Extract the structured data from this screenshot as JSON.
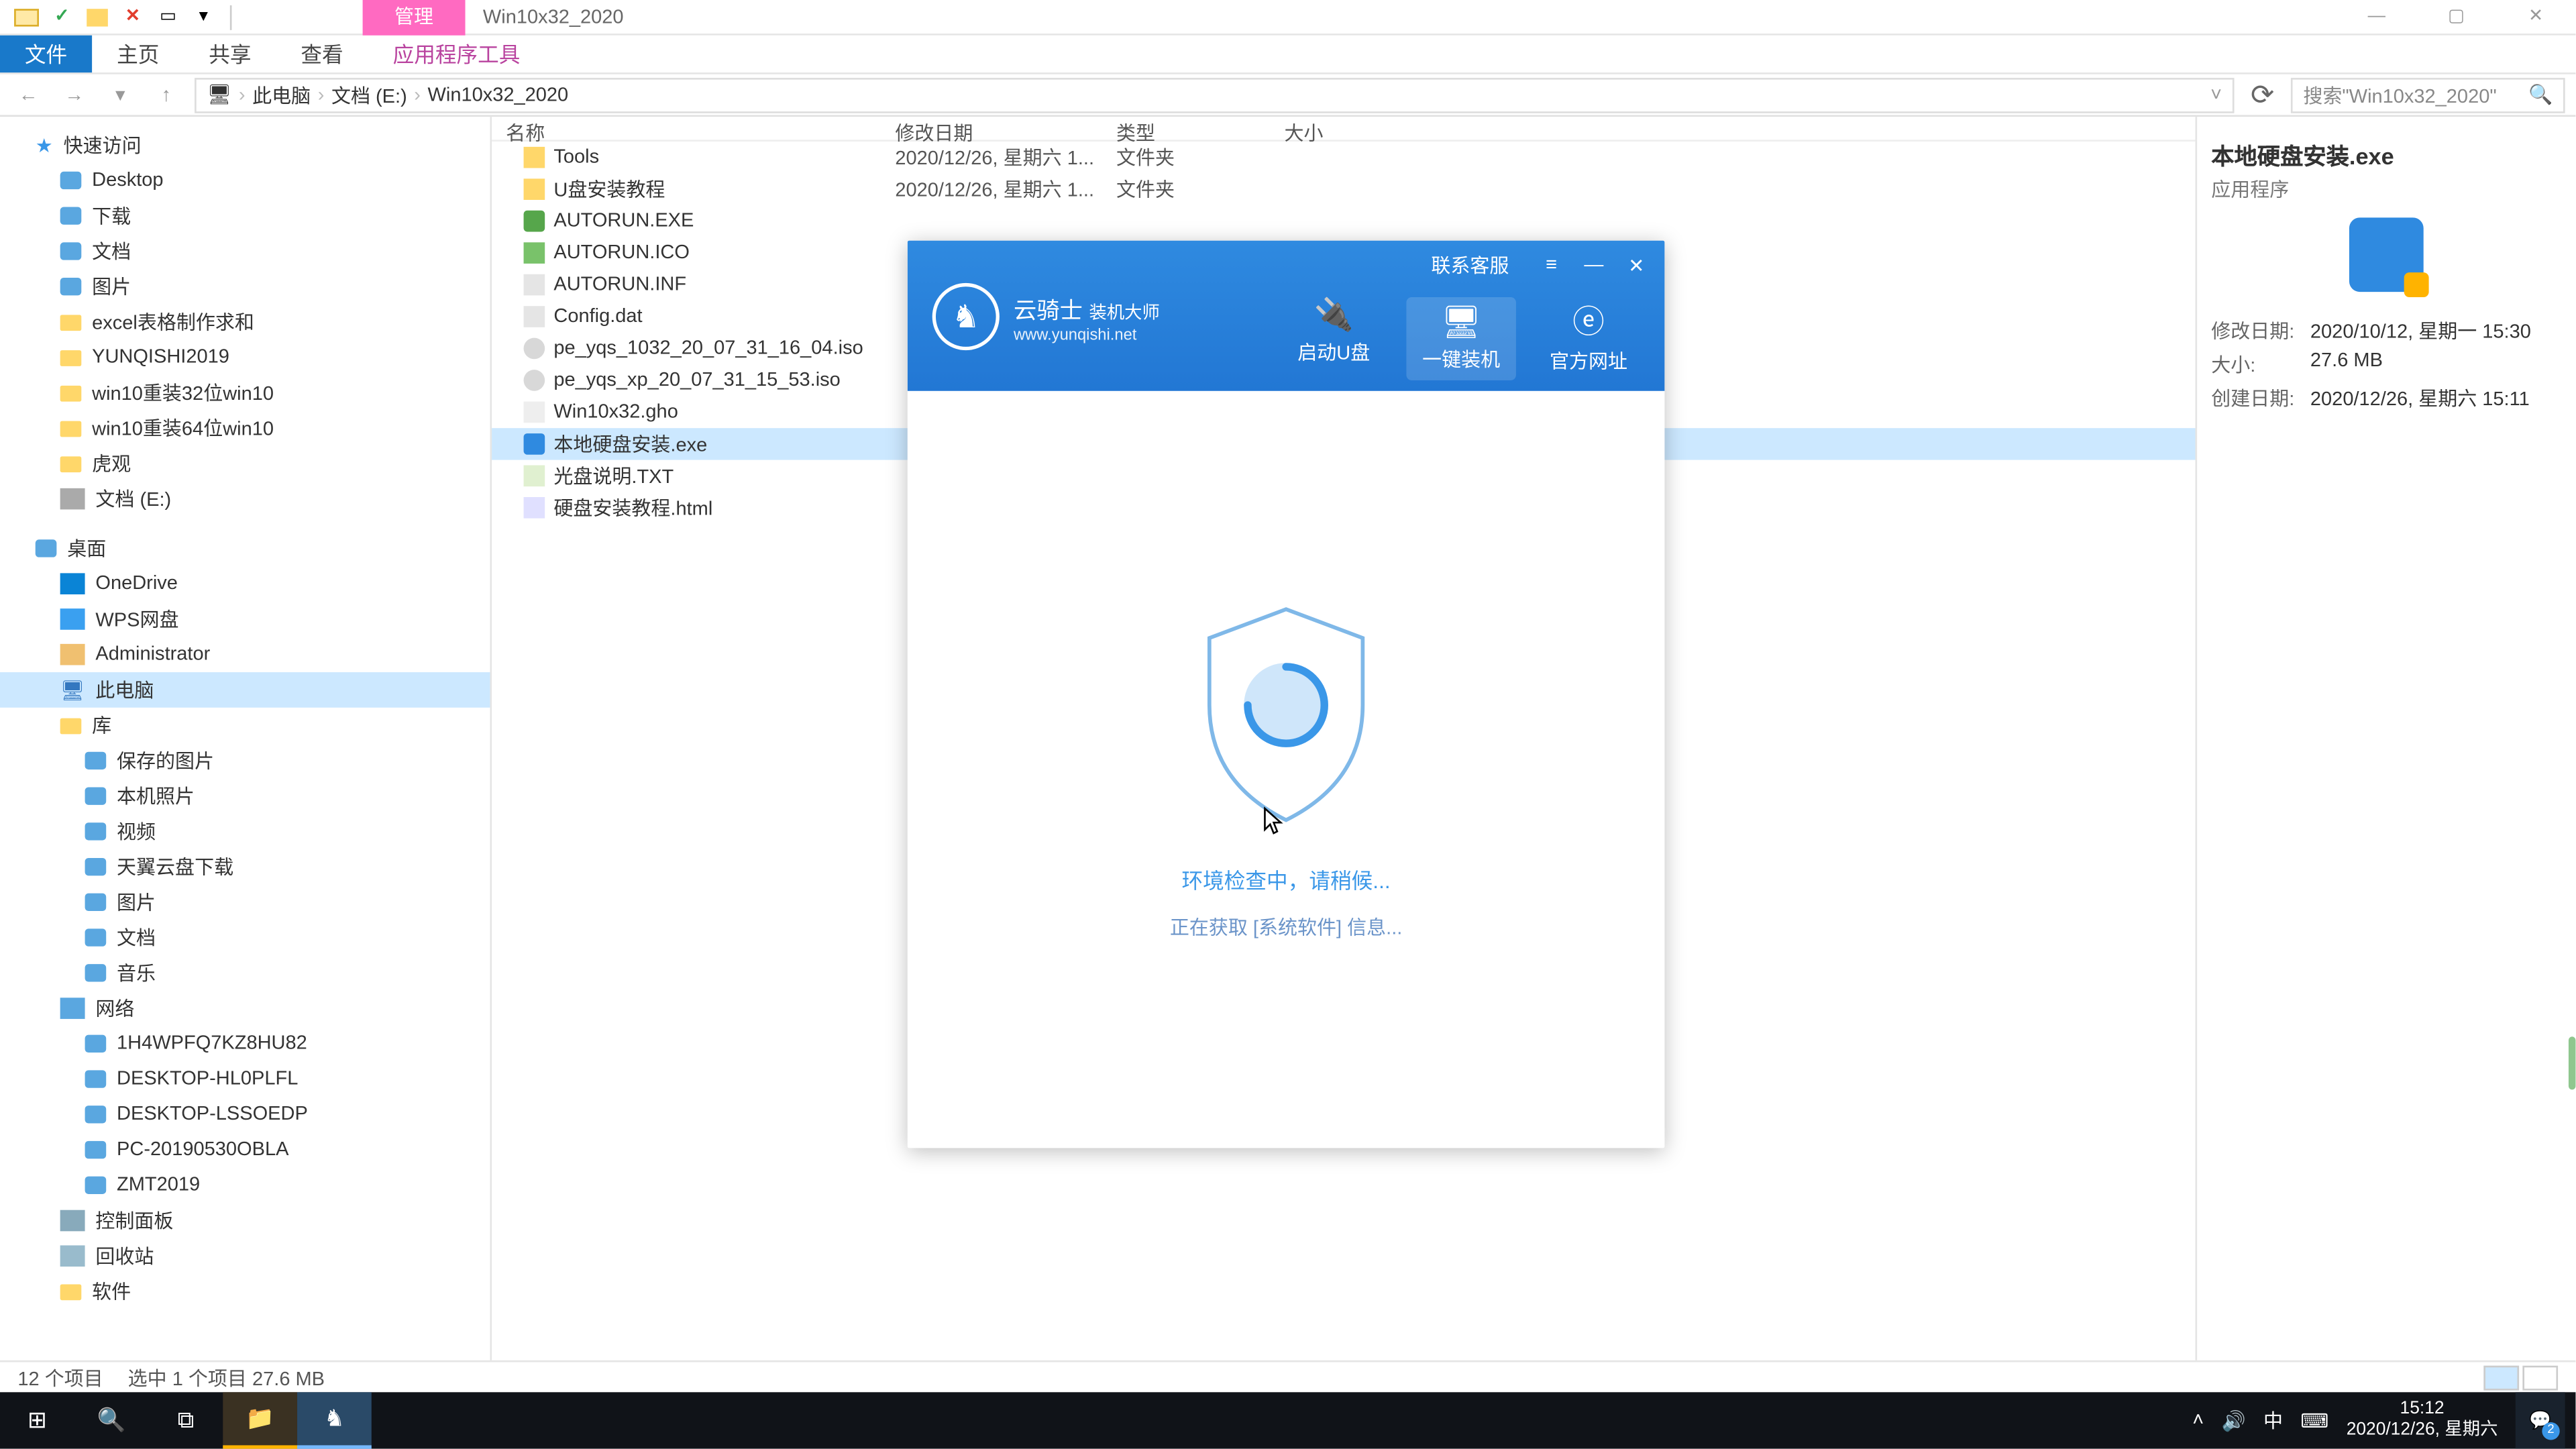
{
  "window": {
    "contextTab": "管理",
    "title": "Win10x32_2020",
    "ribbon": {
      "file": "文件",
      "home": "主页",
      "share": "共享",
      "view": "查看",
      "tools": "应用程序工具"
    }
  },
  "breadcrumbs": {
    "pc": "此电脑",
    "docs": "文档 (E:)",
    "folder": "Win10x32_2020"
  },
  "search": {
    "placeholder": "搜索\"Win10x32_2020\""
  },
  "nav": {
    "quick": "快速访问",
    "desktop": "Desktop",
    "downloads": "下载",
    "docs": "文档",
    "pics": "图片",
    "excel": "excel表格制作求和",
    "yun": "YUNQISHI2019",
    "w32": "win10重装32位win10",
    "w64": "win10重装64位win10",
    "huguan": "虎观",
    "edrive": "文档 (E:)",
    "desk2": "桌面",
    "onedrive": "OneDrive",
    "wps": "WPS网盘",
    "admin": "Administrator",
    "thispc": "此电脑",
    "lib": "库",
    "savedpics": "保存的图片",
    "localpics": "本机照片",
    "video": "视频",
    "tycloud": "天翼云盘下载",
    "pics2": "图片",
    "docs2": "文档",
    "music": "音乐",
    "network": "网络",
    "n1": "1H4WPFQ7KZ8HU82",
    "n2": "DESKTOP-HL0PLFL",
    "n3": "DESKTOP-LSSOEDP",
    "n4": "PC-20190530OBLA",
    "n5": "ZMT2019",
    "cp": "控制面板",
    "recycle": "回收站",
    "soft": "软件"
  },
  "cols": {
    "name": "名称",
    "date": "修改日期",
    "type": "类型",
    "size": "大小"
  },
  "files": [
    {
      "n": "Tools",
      "d": "2020/12/26, 星期六 1...",
      "t": "文件夹",
      "ic": "folder"
    },
    {
      "n": "U盘安装教程",
      "d": "2020/12/26, 星期六 1...",
      "t": "文件夹",
      "ic": "folder"
    },
    {
      "n": "AUTORUN.EXE",
      "d": "",
      "t": "",
      "ic": "exe"
    },
    {
      "n": "AUTORUN.ICO",
      "d": "",
      "t": "",
      "ic": "ico"
    },
    {
      "n": "AUTORUN.INF",
      "d": "",
      "t": "",
      "ic": "dat"
    },
    {
      "n": "Config.dat",
      "d": "",
      "t": "",
      "ic": "dat"
    },
    {
      "n": "pe_yqs_1032_20_07_31_16_04.iso",
      "d": "",
      "t": "",
      "ic": "iso"
    },
    {
      "n": "pe_yqs_xp_20_07_31_15_53.iso",
      "d": "",
      "t": "",
      "ic": "iso"
    },
    {
      "n": "Win10x32.gho",
      "d": "",
      "t": "",
      "ic": "gho"
    },
    {
      "n": "本地硬盘安装.exe",
      "d": "",
      "t": "",
      "ic": "exe2",
      "sel": true
    },
    {
      "n": "光盘说明.TXT",
      "d": "",
      "t": "",
      "ic": "txt"
    },
    {
      "n": "硬盘安装教程.html",
      "d": "",
      "t": "",
      "ic": "html"
    }
  ],
  "details": {
    "title": "本地硬盘安装.exe",
    "sub": "应用程序",
    "k1": "修改日期:",
    "v1": "2020/10/12, 星期一 15:30",
    "k2": "大小:",
    "v2": "27.6 MB",
    "k3": "创建日期:",
    "v3": "2020/12/26, 星期六 15:11"
  },
  "dialog": {
    "contact": "联系客服",
    "brand": "云骑士",
    "brand2": "装机大师",
    "url": "www.yunqishi.net",
    "t1": "启动U盘",
    "t2": "一键装机",
    "t3": "官方网址",
    "msg1": "环境检查中，请稍候...",
    "msg2": "正在获取 [系统软件] 信息..."
  },
  "status": {
    "items": "12 个项目",
    "sel": "选中 1 个项目  27.6 MB"
  },
  "tray": {
    "ime": "中",
    "time": "15:12",
    "date": "2020/12/26, 星期六",
    "badge": "2"
  }
}
